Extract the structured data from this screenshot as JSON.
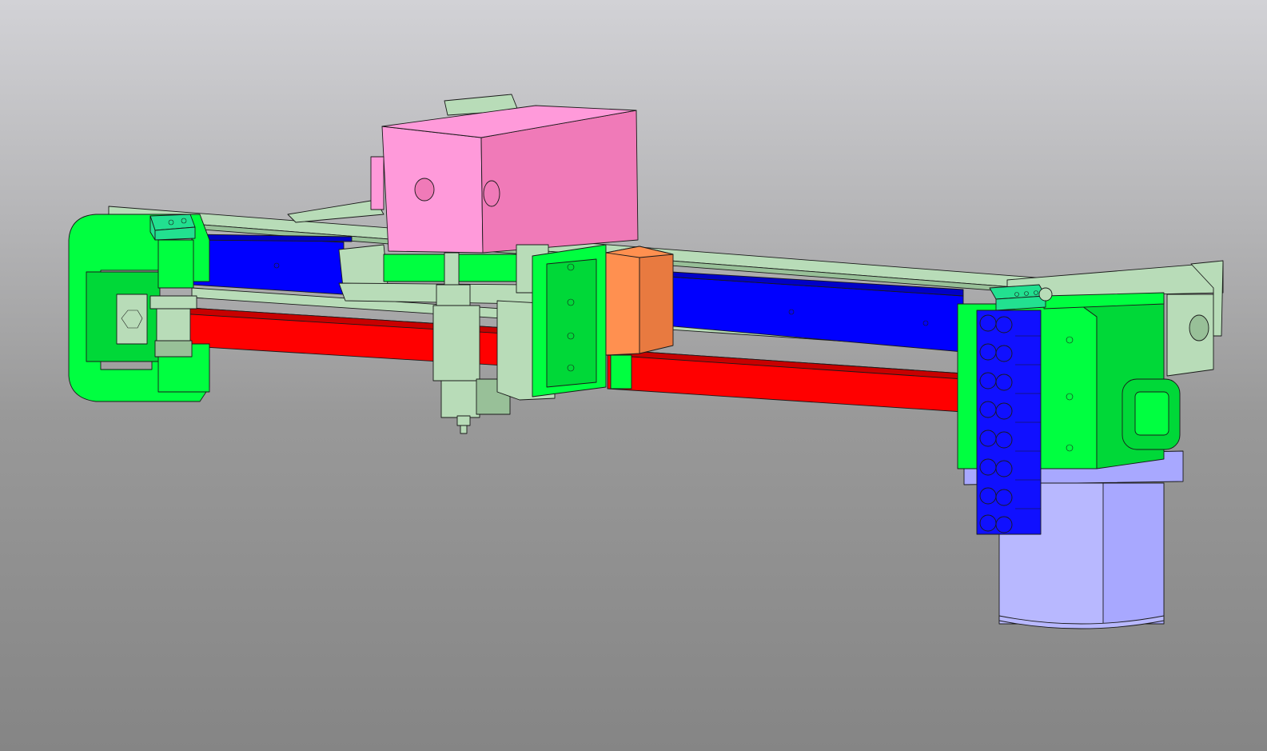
{
  "viewport": {
    "background_top": "#d2d2d6",
    "background_bottom": "#858585"
  },
  "model": {
    "colors": {
      "frame_green": "#00ff40",
      "frame_green_shade": "#00d838",
      "rail_blue": "#0000ff",
      "rail_blue_shade": "#0000c8",
      "belt_red": "#ff0000",
      "belt_red_shade": "#c80000",
      "motor_pink": "#f07ab8",
      "motor_pink_light": "#ff9ada",
      "bracket_sage": "#b8dcb8",
      "bracket_sage_dark": "#98c098",
      "carriage_orange": "#ff9050",
      "carriage_orange_shade": "#e87a40",
      "motor_lavender": "#a8a8ff",
      "motor_lavender_light": "#b8b8ff",
      "block_teal": "#22e090",
      "terminal_blue": "#1010ff"
    }
  }
}
